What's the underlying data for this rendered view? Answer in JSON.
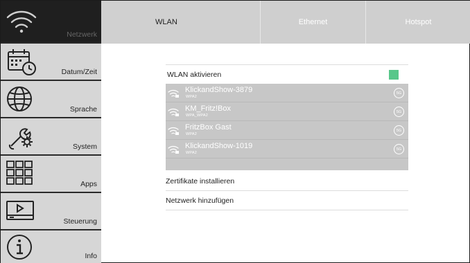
{
  "sidebar": {
    "items": [
      {
        "label": "Netzwerk",
        "icon": "wifi-icon",
        "active": true
      },
      {
        "label": "Datum/Zeit",
        "icon": "calendar-clock-icon"
      },
      {
        "label": "Sprache",
        "icon": "globe-icon"
      },
      {
        "label": "System",
        "icon": "wrench-gear-icon"
      },
      {
        "label": "Apps",
        "icon": "grid-icon"
      },
      {
        "label": "Steuerung",
        "icon": "play-screen-icon"
      },
      {
        "label": "Info",
        "icon": "info-icon"
      }
    ]
  },
  "tabs": [
    {
      "label": "WLAN",
      "active": true
    },
    {
      "label": "Ethernet"
    },
    {
      "label": "Hotspot"
    }
  ],
  "wlan": {
    "enable_label": "WLAN aktivieren",
    "enabled": true,
    "toggle_color": "#58c78a",
    "networks": [
      {
        "name": "KlickandShow-3879",
        "security": "WPA2",
        "band": "5G"
      },
      {
        "name": "KM_Fritz!Box",
        "security": "WPA_WPA2",
        "band": "5G"
      },
      {
        "name": "FritzBox Gast",
        "security": "WPA2",
        "band": "5G"
      },
      {
        "name": "KlickandShow-1019",
        "security": "WPA2",
        "band": "5G"
      }
    ],
    "actions": [
      {
        "label": "Zertifikate installieren"
      },
      {
        "label": "Netzwerk hinzufügen"
      }
    ]
  }
}
